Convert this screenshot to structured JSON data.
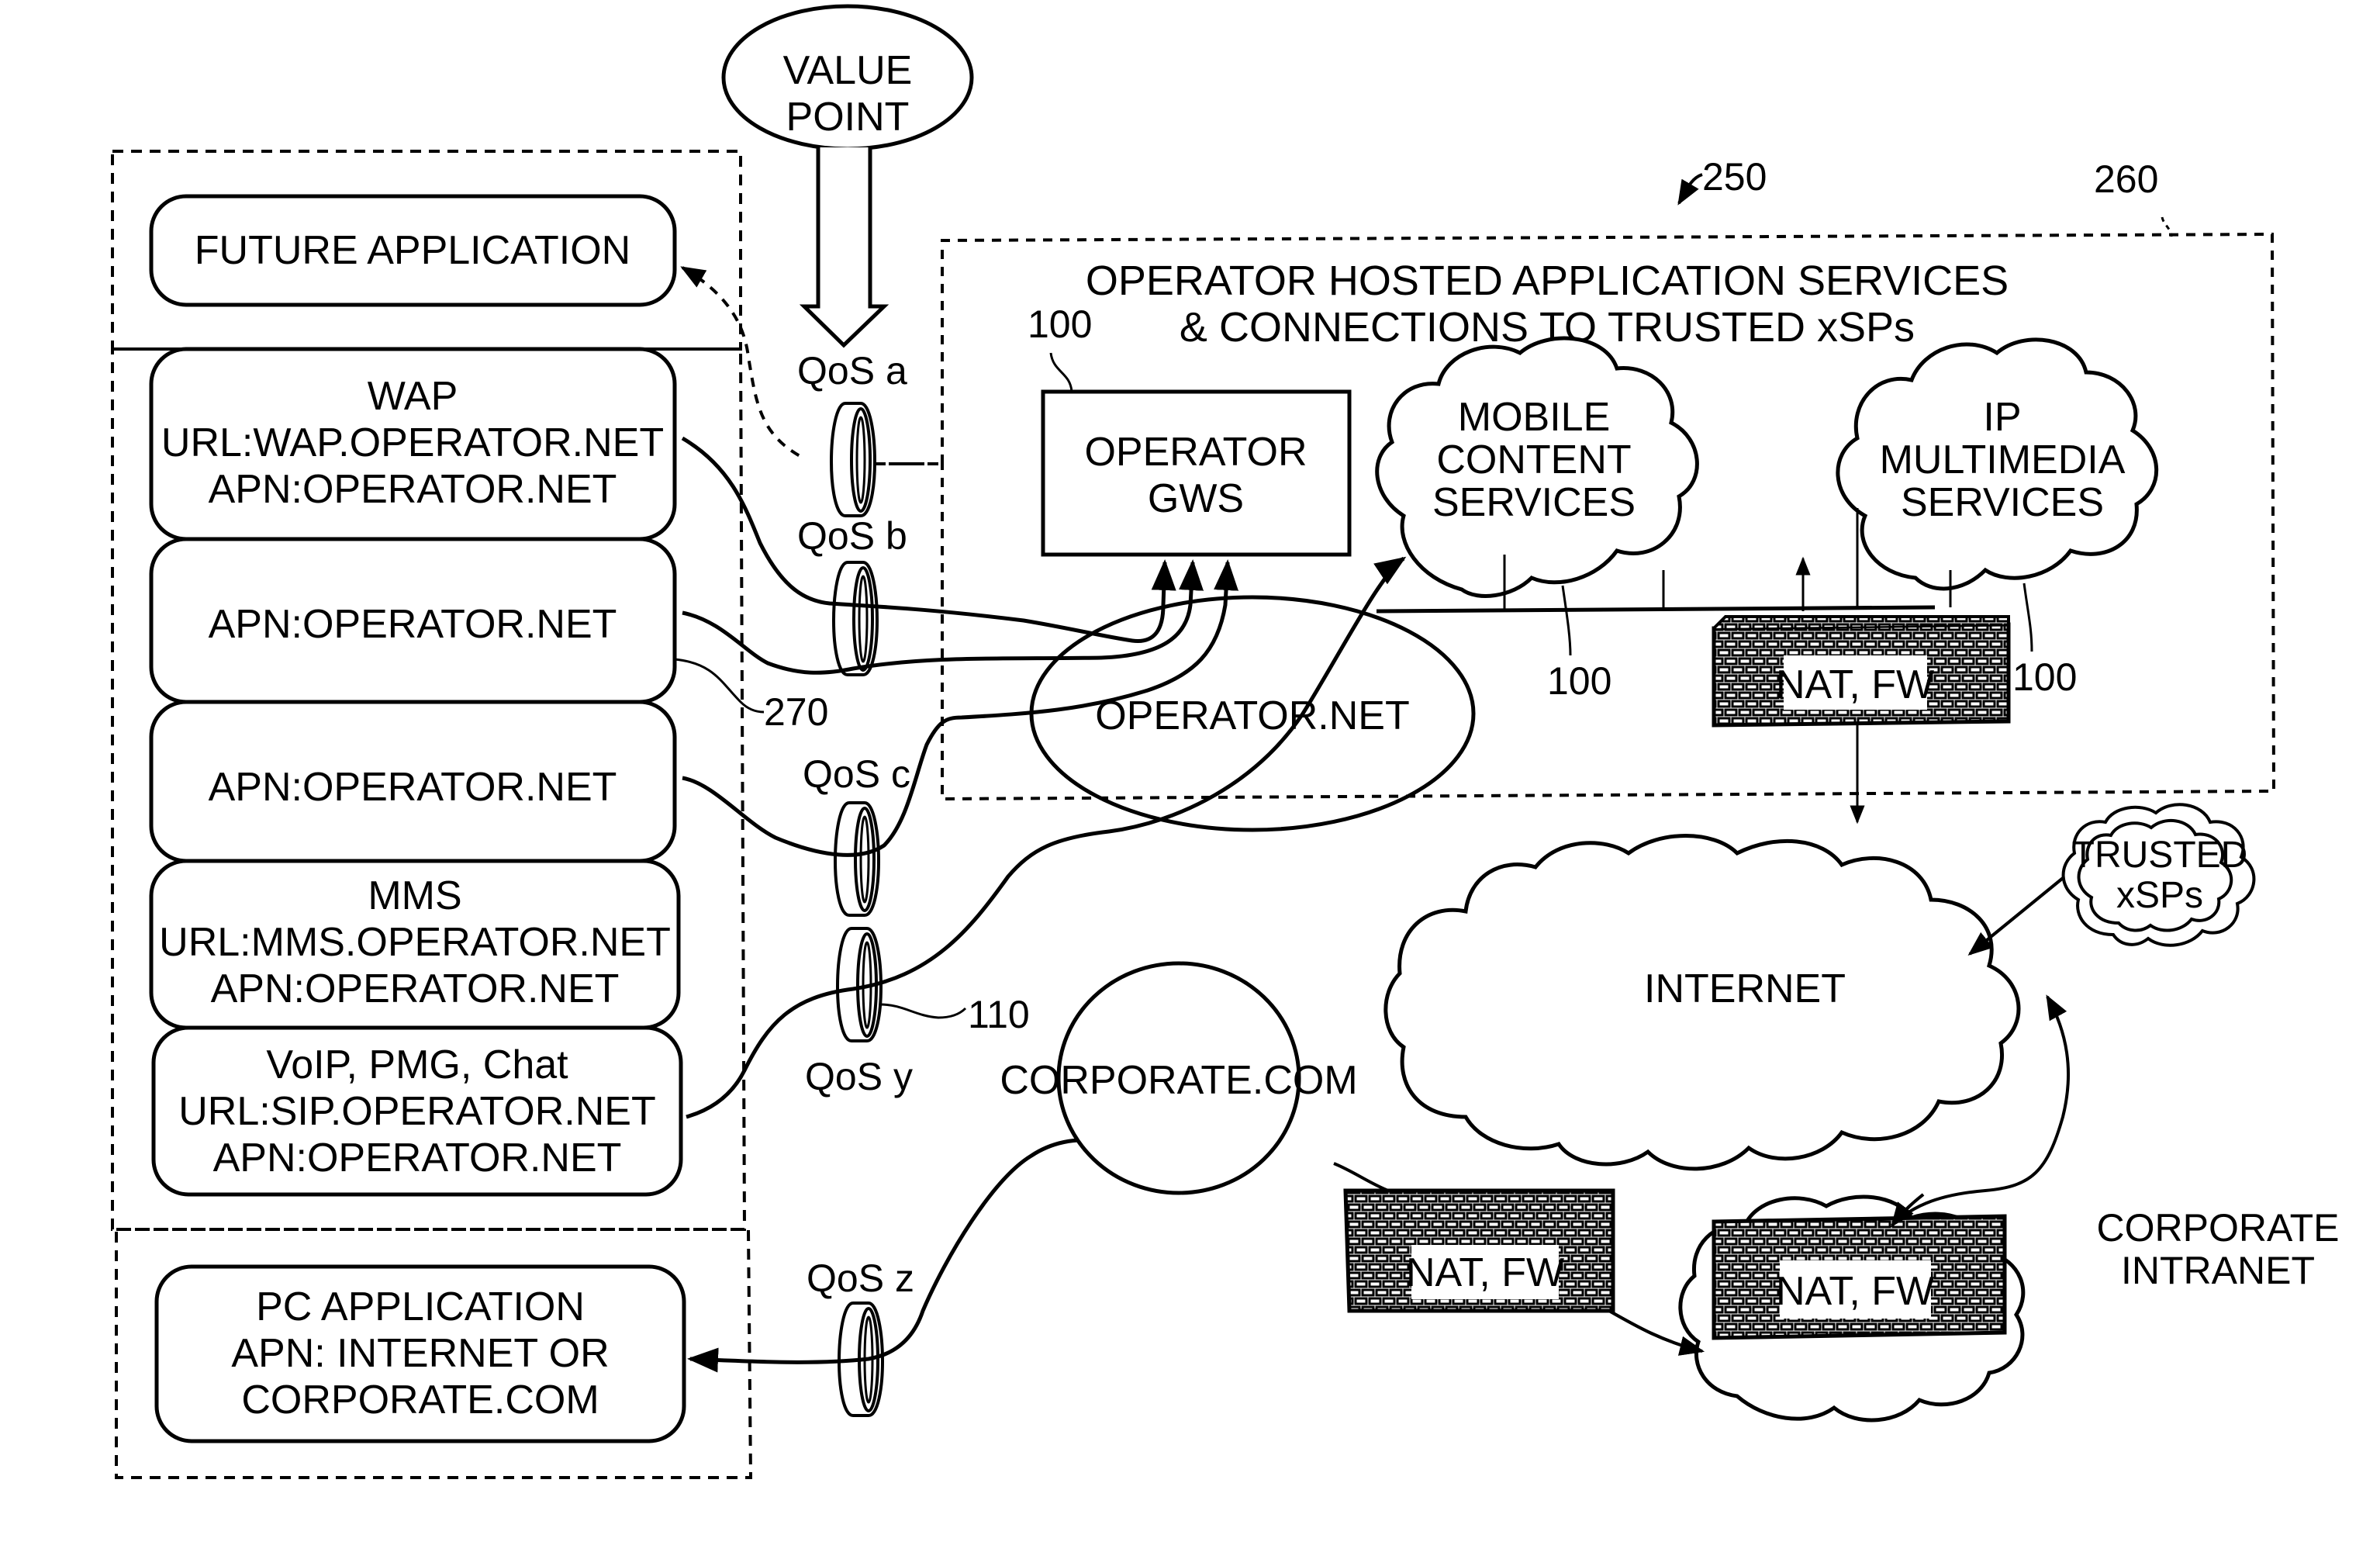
{
  "value_point": {
    "lines": [
      "VALUE",
      "POINT"
    ]
  },
  "reference_numerals": {
    "system": "250",
    "hosted_region": "260",
    "gateway": "100",
    "mobile_content": "100",
    "ip_multimedia": "100",
    "apn_box": "270",
    "qos_pipe": "110"
  },
  "hosted_region": {
    "title_lines": [
      "OPERATOR HOSTED APPLICATION SERVICES",
      "& CONNECTIONS TO TRUSTED xSPs"
    ]
  },
  "applications": [
    {
      "lines": [
        "FUTURE APPLICATION"
      ]
    },
    {
      "lines": [
        "WAP",
        "URL:WAP.OPERATOR.NET",
        "APN:OPERATOR.NET"
      ]
    },
    {
      "lines": [
        "APN:OPERATOR.NET"
      ]
    },
    {
      "lines": [
        "APN:OPERATOR.NET"
      ]
    },
    {
      "lines": [
        "MMS",
        "URL:MMS.OPERATOR.NET",
        "APN:OPERATOR.NET"
      ]
    },
    {
      "lines": [
        "VoIP, PMG, Chat",
        "URL:SIP.OPERATOR.NET",
        "APN:OPERATOR.NET"
      ]
    },
    {
      "lines": [
        "PC APPLICATION",
        "APN: INTERNET OR",
        "CORPORATE.COM"
      ]
    }
  ],
  "qos_labels": [
    "QoS a",
    "QoS b",
    "QoS c",
    "QoS y",
    "QoS z"
  ],
  "nodes": {
    "gateway": [
      "OPERATOR",
      "GWS"
    ],
    "mobile_content": [
      "MOBILE",
      "CONTENT",
      "SERVICES"
    ],
    "ip_multimedia": [
      "IP",
      "MULTIMEDIA",
      "SERVICES"
    ],
    "operator_net": "OPERATOR.NET",
    "internet": "INTERNET",
    "trusted": [
      "TRUSTED",
      "xSPs"
    ],
    "corporate_com": "CORPORATE.COM",
    "corporate_intranet": [
      "CORPORATE",
      "INTRANET"
    ]
  },
  "firewalls": [
    "NAT, FW",
    "NAT, FW",
    "NAT, FW"
  ]
}
